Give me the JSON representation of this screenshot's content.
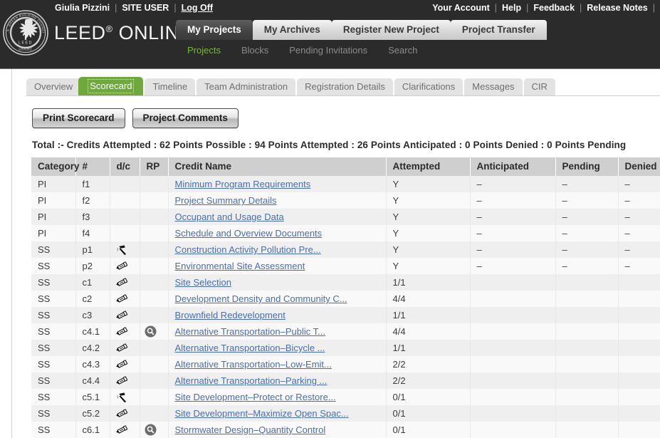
{
  "header": {
    "user_name": "Giulia Pizzini",
    "user_role": "SITE USER",
    "logoff": "Log Off",
    "sep": "|",
    "right_links": [
      "Your Account",
      "Help",
      "Feedback",
      "Release Notes"
    ],
    "brand": "LEED",
    "brand_reg": "®",
    "brand_online": "ONLINE",
    "brand_tm": "™",
    "logo_text_top": "U.S. GREEN BUILDING COUNCIL",
    "logo_text_mid": "LEED",
    "logo_text_bottom": "USGBC"
  },
  "main_tabs": [
    {
      "label": "My Projects",
      "active": true
    },
    {
      "label": "My Archives",
      "active": false
    },
    {
      "label": "Register New Project",
      "active": false
    },
    {
      "label": "Project Transfer",
      "active": false
    }
  ],
  "sub_nav": [
    {
      "label": "Projects",
      "active": true
    },
    {
      "label": "Blocks",
      "active": false
    },
    {
      "label": "Pending Invitations",
      "active": false
    },
    {
      "label": "Search",
      "active": false
    }
  ],
  "project_tabs": [
    {
      "label": "Overview",
      "active": false
    },
    {
      "label": "Scorecard",
      "active": true
    },
    {
      "label": "Timeline",
      "active": false
    },
    {
      "label": "Team Administration",
      "active": false
    },
    {
      "label": "Registration Details",
      "active": false
    },
    {
      "label": "Clarifications",
      "active": false
    },
    {
      "label": "Messages",
      "active": false
    },
    {
      "label": "CIR",
      "active": false
    }
  ],
  "buttons": {
    "print_scorecard": "Print Scorecard",
    "project_comments": "Project Comments"
  },
  "totals": {
    "line": "Total :-  Credits Attempted : 62 Points Possible : 94 Points Attempted : 26 Points Anticipated : 0 Points Denied : 0 Points Pending",
    "label": "Total :-",
    "credits_attempted_label": "Credits Attempted :",
    "credits_attempted": "62",
    "points_possible_label": "Points Possible :",
    "points_possible": "94",
    "points_attempted_label": "Points Attempted :",
    "points_attempted": "26",
    "points_anticipated_label": "Points Anticipated :",
    "points_anticipated": "0",
    "points_denied_label": "Points Denied :",
    "points_denied": "0",
    "points_pending_label": "Points Pending"
  },
  "table": {
    "columns": [
      "Category",
      "#",
      "d/c",
      "RP",
      "Credit Name",
      "Attempted",
      "Anticipated",
      "Pending",
      "Denied"
    ],
    "rows": [
      {
        "category": "PI",
        "num": "f1",
        "dc": "",
        "rp": "",
        "name": "Minimum Program Requirements",
        "attempted": "Y",
        "anticipated": "–",
        "pending": "–",
        "denied": "–"
      },
      {
        "category": "PI",
        "num": "f2",
        "dc": "",
        "rp": "",
        "name": "Project Summary Details",
        "attempted": "Y",
        "anticipated": "–",
        "pending": "–",
        "denied": "–"
      },
      {
        "category": "PI",
        "num": "f3",
        "dc": "",
        "rp": "",
        "name": "Occupant and Usage Data",
        "attempted": "Y",
        "anticipated": "–",
        "pending": "–",
        "denied": "–"
      },
      {
        "category": "PI",
        "num": "f4",
        "dc": "",
        "rp": "",
        "name": "Schedule and Overview Documents",
        "attempted": "Y",
        "anticipated": "–",
        "pending": "–",
        "denied": "–"
      },
      {
        "category": "SS",
        "num": "p1",
        "dc": "hammer-icon",
        "rp": "",
        "name": "Construction Activity Pollution Pre...",
        "attempted": "Y",
        "anticipated": "–",
        "pending": "–",
        "denied": "–"
      },
      {
        "category": "SS",
        "num": "p2",
        "dc": "pencil-icon",
        "rp": "",
        "name": "Environmental Site Assessment",
        "attempted": "Y",
        "anticipated": "–",
        "pending": "–",
        "denied": "–"
      },
      {
        "category": "SS",
        "num": "c1",
        "dc": "pencil-icon",
        "rp": "",
        "name": "Site Selection",
        "attempted": "1/1",
        "anticipated": "",
        "pending": "",
        "denied": ""
      },
      {
        "category": "SS",
        "num": "c2",
        "dc": "pencil-icon",
        "rp": "",
        "name": "Development Density and Community C...",
        "attempted": "4/4",
        "anticipated": "",
        "pending": "",
        "denied": ""
      },
      {
        "category": "SS",
        "num": "c3",
        "dc": "pencil-icon",
        "rp": "",
        "name": "Brownfield Redevelopment",
        "attempted": "1/1",
        "anticipated": "",
        "pending": "",
        "denied": ""
      },
      {
        "category": "SS",
        "num": "c4.1",
        "dc": "pencil-icon",
        "rp": "magnifier-icon",
        "name": "Alternative Transportation–Public T...",
        "attempted": "4/4",
        "anticipated": "",
        "pending": "",
        "denied": ""
      },
      {
        "category": "SS",
        "num": "c4.2",
        "dc": "pencil-icon",
        "rp": "",
        "name": "Alternative Transportation–Bicycle ...",
        "attempted": "1/1",
        "anticipated": "",
        "pending": "",
        "denied": ""
      },
      {
        "category": "SS",
        "num": "c4.3",
        "dc": "pencil-icon",
        "rp": "",
        "name": "Alternative Transportation–Low-Emit...",
        "attempted": "2/2",
        "anticipated": "",
        "pending": "",
        "denied": ""
      },
      {
        "category": "SS",
        "num": "c4.4",
        "dc": "pencil-icon",
        "rp": "",
        "name": "Alternative Transportation–Parking ...",
        "attempted": "2/2",
        "anticipated": "",
        "pending": "",
        "denied": ""
      },
      {
        "category": "SS",
        "num": "c5.1",
        "dc": "hammer-icon",
        "rp": "",
        "name": "Site Development–Protect or Restore...",
        "attempted": "0/1",
        "anticipated": "",
        "pending": "",
        "denied": ""
      },
      {
        "category": "SS",
        "num": "c5.2",
        "dc": "pencil-icon",
        "rp": "",
        "name": "Site Development–Maximize Open Spac...",
        "attempted": "0/1",
        "anticipated": "",
        "pending": "",
        "denied": ""
      },
      {
        "category": "SS",
        "num": "c6.1",
        "dc": "pencil-icon",
        "rp": "magnifier-icon",
        "name": "Stormwater Design–Quantity Control",
        "attempted": "0/1",
        "anticipated": "",
        "pending": "",
        "denied": ""
      }
    ]
  },
  "colors": {
    "header_bg": "#2b2b2b",
    "accent_green": "#6fa83c",
    "subnav_green": "#7ab83c",
    "link_blue": "#4a6ea9",
    "table_header_bg": "#cfcfcf",
    "row_odd": "#efefef",
    "row_even": "#f9f9f9"
  }
}
